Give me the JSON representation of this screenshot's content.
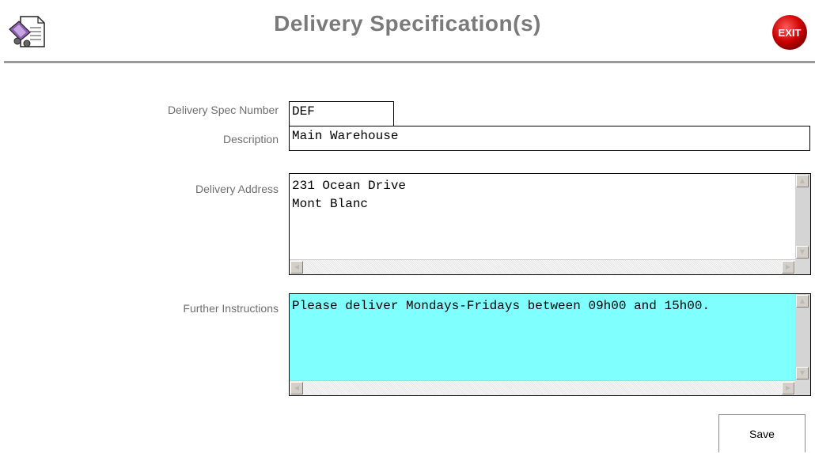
{
  "header": {
    "title": "Delivery Specification(s)",
    "exit_label": "EXIT",
    "app_icon": "document-delivery-icon",
    "exit_color": "#c00000"
  },
  "form": {
    "spec_number": {
      "label": "Delivery Spec Number",
      "value": "DEF"
    },
    "description": {
      "label": "Description",
      "value": "Main Warehouse"
    },
    "address": {
      "label": "Delivery Address",
      "value": "231 Ocean Drive\nMont Blanc"
    },
    "instructions": {
      "label": "Further Instructions",
      "value": "Please deliver Mondays-Fridays between 09h00 and 15h00.",
      "background": "#80ffff"
    }
  },
  "actions": {
    "save_label": "Save"
  }
}
